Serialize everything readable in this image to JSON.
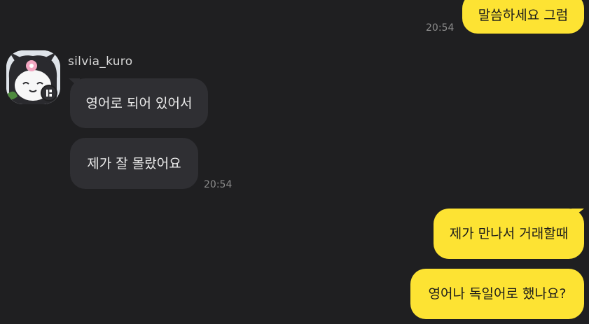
{
  "chat": {
    "sender_name": "silvia_kuro",
    "messages": [
      {
        "side": "mine",
        "text": "말씀하세요 그럼",
        "time": "20:54"
      },
      {
        "side": "theirs",
        "text": "영어로 되어 있어서"
      },
      {
        "side": "theirs",
        "text": "제가 잘 몰랐어요",
        "time": "20:54"
      },
      {
        "side": "mine",
        "text": "제가 만나서 거래할때"
      },
      {
        "side": "mine",
        "text": "영어나 독일어로 했나요?"
      }
    ]
  },
  "colors": {
    "background": "#1f1f21",
    "my_bubble": "#fde333",
    "their_bubble": "#2f2f33",
    "timestamp": "#8c8c8c"
  },
  "icons": {
    "avatar": "kuromi-character-avatar",
    "avatar_badge": "profile-badge-icon"
  }
}
